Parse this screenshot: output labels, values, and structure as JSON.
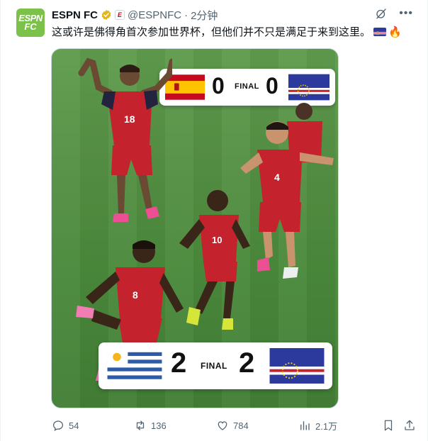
{
  "tweet": {
    "author_name": "ESPN FC",
    "org_badge": "E",
    "handle": "@ESPNFC",
    "dot": "·",
    "time": "2分钟",
    "avatar_line1": "ESPN",
    "avatar_line2": "FC",
    "text": "这或许是佛得角首次参加世界杯，但他们并不只是满足于来到这里。"
  },
  "media": {
    "top_card": {
      "home_team_flag": "spain-flag",
      "home_score": "0",
      "label": "FINAL",
      "away_score": "0",
      "away_team_flag": "cape-verde-flag"
    },
    "bottom_card": {
      "home_team_flag": "uruguay-flag",
      "home_score": "2",
      "label": "FINAL",
      "away_score": "2",
      "away_team_flag": "cape-verde-flag"
    },
    "jersey_numbers": [
      "18",
      "4",
      "10",
      "8"
    ]
  },
  "actions": {
    "replies": "54",
    "reposts": "136",
    "likes": "784",
    "views": "2.1万"
  },
  "colors": {
    "accent": "#1d9bf0",
    "muted": "#536471",
    "cape_verde_blue": "#2b3a9c",
    "jersey_red": "#c4232e",
    "pitch_green": "#548f43"
  }
}
